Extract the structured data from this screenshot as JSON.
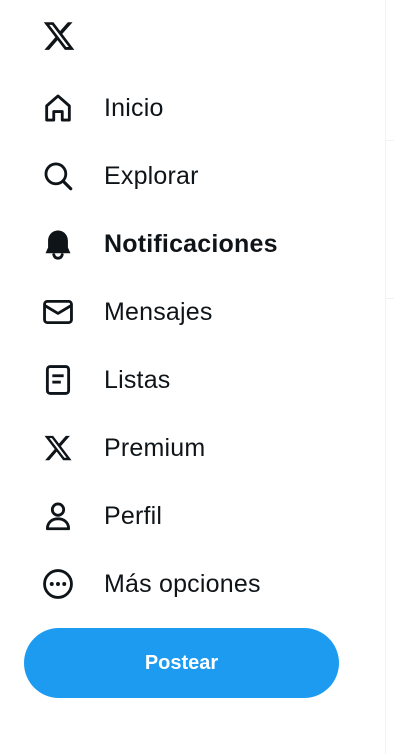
{
  "colors": {
    "text": "#0f1419",
    "accent": "#1d9bf0",
    "divider": "#eff3f4"
  },
  "logo": {
    "icon": "x-logo-icon"
  },
  "nav": {
    "items": [
      {
        "label": "Inicio",
        "icon": "home-icon",
        "active": false
      },
      {
        "label": "Explorar",
        "icon": "search-icon",
        "active": false
      },
      {
        "label": "Notificaciones",
        "icon": "bell-icon",
        "active": true
      },
      {
        "label": "Mensajes",
        "icon": "envelope-icon",
        "active": false
      },
      {
        "label": "Listas",
        "icon": "list-icon",
        "active": false
      },
      {
        "label": "Premium",
        "icon": "x-logo-icon",
        "active": false
      },
      {
        "label": "Perfil",
        "icon": "person-icon",
        "active": false
      },
      {
        "label": "Más opciones",
        "icon": "more-circle-icon",
        "active": false
      }
    ]
  },
  "post_button": {
    "label": "Postear"
  }
}
